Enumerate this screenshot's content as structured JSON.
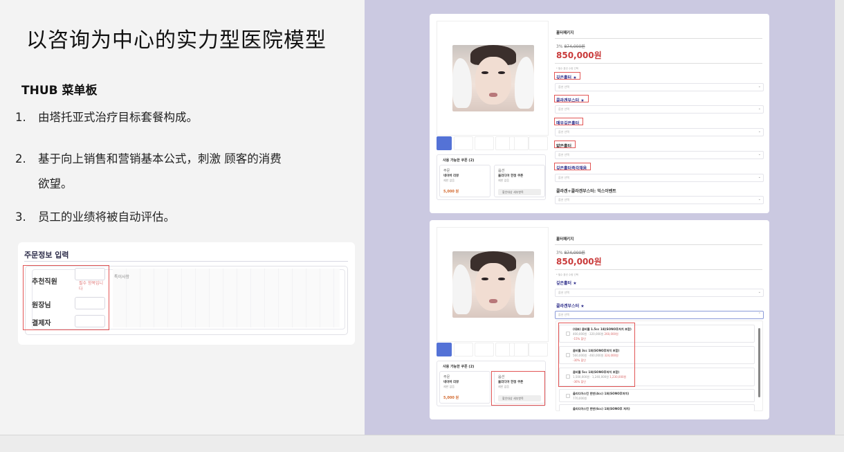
{
  "slide": {
    "title": "以咨询为中心的实力型医院模型",
    "subtitle": "THUB 菜单板",
    "items": [
      {
        "num": "1.",
        "text": "由塔托亚式治疗目标套餐构成。"
      },
      {
        "num": "2.",
        "text": "基于向上销售和营销基本公式，刺激 顾客的消费",
        "cont": "欲望。"
      },
      {
        "num": "3.",
        "text": "员工的业绩将被自动评估。"
      }
    ]
  },
  "order_form": {
    "title": "주문정보 입력",
    "fields": [
      "추천직원",
      "원장님",
      "결제자"
    ],
    "hint": "필수 항목입니다",
    "memo": "특이사항"
  },
  "card1": {
    "package": "홀터패키지",
    "discount": "3%",
    "old_price": "874,000원",
    "price": "850,000원",
    "note": "* 필수 옵션 수량 선택",
    "options": [
      {
        "label": "깊은홀터",
        "star": "★"
      },
      {
        "label": "콜라겐부스터",
        "star": "★"
      },
      {
        "label": "매우깊은홀터",
        "star": ""
      },
      {
        "label": "얇은홀터",
        "star": ""
      },
      {
        "label": "깊은홀터즉각채움",
        "star": ""
      },
      {
        "label": "콜라겐+콜라겐부스터: 믹스이벤트",
        "star": ""
      }
    ],
    "select_placeholder": "옵션 선택",
    "coupon_title": "사용 가능한 쿠폰 (2)",
    "coupon_a": {
      "tag": "주문",
      "name": "네이버 리뷰",
      "sub": "제한 없음",
      "amount": "5,000 원"
    },
    "coupon_b": {
      "tag": "옵션",
      "name": "울리디아 한정 쿠폰",
      "sub": "제한 없음",
      "btn": "할인대상 세부항목"
    }
  },
  "card2": {
    "package": "홀터패키지",
    "discount": "3%",
    "old_price": "874,000원",
    "price": "850,000원",
    "note": "* 필수 옵션 수량 선택",
    "options": [
      {
        "label": "깊은홀터",
        "star": "★"
      },
      {
        "label": "콜라겐부스터",
        "star": "★"
      }
    ],
    "select_placeholder": "옵션 선택",
    "dropdown": [
      {
        "name": "(대표) 콤비홀 1.5cc 1회(SONO후처치 포함)",
        "prices": "400,000원 · 320,000원",
        "pct": "-15% 할인",
        "sale": "260,000원"
      },
      {
        "name": "콤비홀 3cc 1회(SONO후처치 포함)",
        "prices": "560,000원 · 460,000원",
        "pct": "-30% 할인",
        "sale": "324,000원"
      },
      {
        "name": "콤비홀 5cc 1회(SONO후처치 포함)",
        "prices": "1,500,000원 · 1,240,000원",
        "pct": "-36% 할인",
        "sale": "1,230,000원"
      },
      {
        "name": "울리디아스킨 한번(4cc) 1회(SONO후처치)",
        "prices": "770,000원",
        "pct": "",
        "sale": ""
      },
      {
        "name": "울리디아스킨 한번(6cc) 1회(SONO후 처치)",
        "prices": "",
        "pct": "",
        "sale": ""
      }
    ],
    "coupon_title": "사용 가능한 쿠폰 (2)",
    "coupon_a": {
      "tag": "주문",
      "name": "네이버 리뷰",
      "sub": "제한 없음",
      "amount": "5,000 원"
    },
    "coupon_b": {
      "tag": "옵션",
      "name": "울리디아 한정 쿠폰",
      "sub": "제한 없음",
      "btn": "할인대상 세부항목"
    }
  },
  "colors": {
    "panel": "#cbc9e1",
    "highlight": "#e25555",
    "price": "#c93a3a",
    "accent": "#5472d6"
  }
}
